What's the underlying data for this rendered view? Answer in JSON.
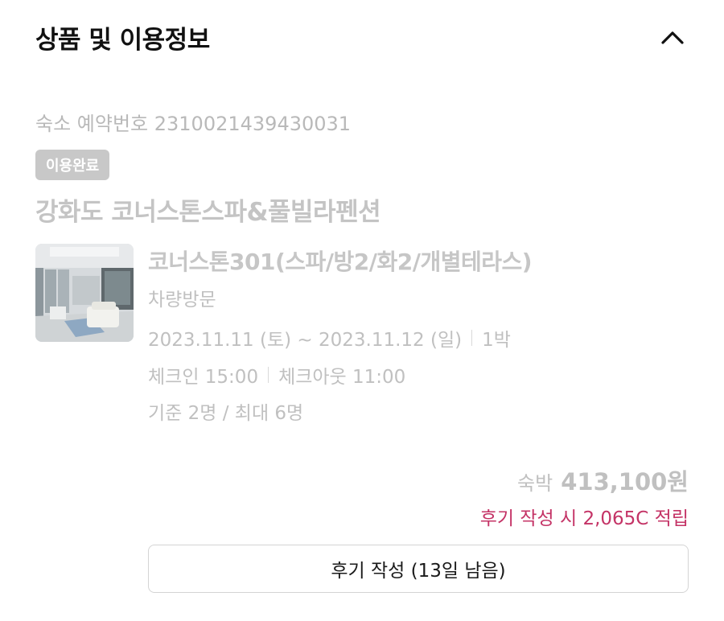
{
  "header": {
    "title": "상품 및 이용정보",
    "collapse_icon": "chevron-up-icon"
  },
  "reservation": {
    "label": "숙소 예약번호",
    "number": "2310021439430031"
  },
  "status_badge": "이용완료",
  "hotel": {
    "name": "강화도 코너스톤스파&풀빌라펜션"
  },
  "room": {
    "name": "코너스톤301(스파/방2/화2/개별테라스)",
    "visit_type": "차량방문",
    "dates": "2023.11.11 (토) ~ 2023.11.12 (일)",
    "nights": "1박",
    "checkin": "체크인 15:00",
    "checkout": "체크아웃 11:00",
    "capacity": "기준 2명 / 최대 6명"
  },
  "price": {
    "label": "숙박",
    "amount": "413,100원"
  },
  "reward": {
    "text": "후기 작성 시 2,065C 적립",
    "color": "#c43366"
  },
  "review_button": {
    "label": "후기 작성 (13일 남음)"
  }
}
